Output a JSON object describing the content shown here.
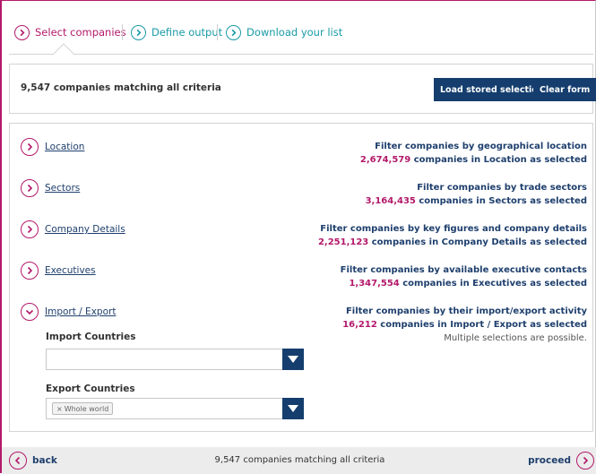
{
  "steps": [
    {
      "label": "Select companies",
      "active": true
    },
    {
      "label": "Define output",
      "active": false
    },
    {
      "label": "Download your list",
      "active": false
    }
  ],
  "match_bar": {
    "text": "9,547 companies matching all criteria",
    "load_button": "Load stored selection",
    "clear_button": "Clear form"
  },
  "filters": [
    {
      "link": "Location",
      "title": "Filter companies by geographical location",
      "count": "2,674,579",
      "suffix": "companies in Location as selected",
      "expanded": false
    },
    {
      "link": "Sectors",
      "title": "Filter companies by trade sectors",
      "count": "3,164,435",
      "suffix": "companies in Sectors as selected",
      "expanded": false
    },
    {
      "link": "Company Details",
      "title": "Filter companies by key figures and company details",
      "count": "2,251,123",
      "suffix": "companies in Company Details as selected",
      "expanded": false
    },
    {
      "link": "Executives",
      "title": "Filter companies by available executive contacts",
      "count": "1,347,554",
      "suffix": "companies in Executives as selected",
      "expanded": false
    },
    {
      "link": "Import / Export",
      "title": "Filter companies by their import/export activity",
      "count": "16,212",
      "suffix": "companies in Import / Export as selected",
      "note": "Multiple selections are possible.",
      "expanded": true
    }
  ],
  "import_export": {
    "import_label": "Import Countries",
    "import_value": "",
    "export_label": "Export Countries",
    "export_tag": "Whole world",
    "tag_remove": "×"
  },
  "footer": {
    "back": "back",
    "match_text": "9,547 companies matching all criteria",
    "proceed": "proceed"
  },
  "colors": {
    "accent": "#b3196a",
    "teal": "#1a9aa6",
    "navy": "#153e6e"
  },
  "icons": {
    "step": "chevron-right-circle-icon",
    "filter_collapsed": "chevron-right-circle-icon",
    "filter_expanded": "chevron-down-circle-icon",
    "dropdown": "caret-down-icon",
    "back": "chevron-left-circle-icon",
    "proceed": "chevron-right-circle-icon"
  }
}
